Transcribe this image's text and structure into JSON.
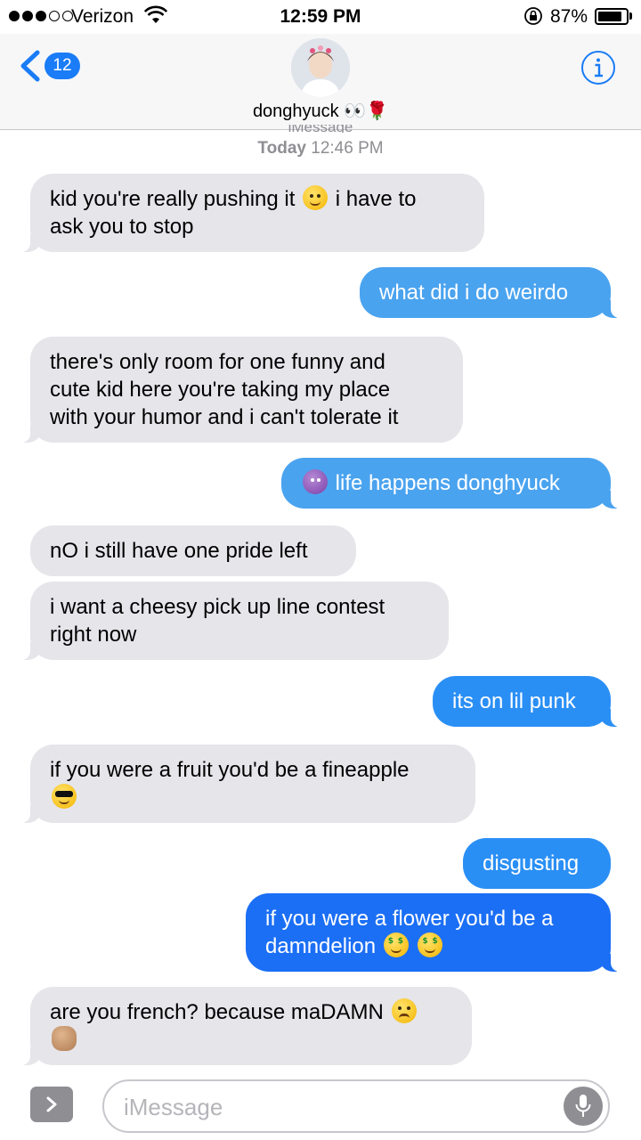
{
  "status_bar": {
    "carrier": "Verizon",
    "time": "12:59 PM",
    "battery_percent": "87%",
    "battery_level": 0.87,
    "signal_bars_filled": 3,
    "signal_bars_total": 5
  },
  "header": {
    "back_count": "12",
    "contact_name": "donghyuck 👀🌹",
    "info_icon": "info-icon"
  },
  "conversation": {
    "meta_label": "iMessage",
    "timestamp_day": "Today",
    "timestamp_time": "12:46 PM"
  },
  "messages": [
    {
      "from": "them",
      "lines": [
        "kid you're really pushing it",
        "ask you to stop"
      ],
      "line1_suffix": "i have to",
      "emoji": "steam-face"
    },
    {
      "from": "me",
      "lines": [
        "what did i do weirdo"
      ]
    },
    {
      "from": "them",
      "lines": [
        "there's only room for one funny and",
        "cute kid here you're taking my place",
        "with your humor and i can't tolerate it"
      ]
    },
    {
      "from": "me",
      "lines": [
        "life happens donghyuck"
      ],
      "emoji": "shrug-woman"
    },
    {
      "from": "them",
      "lines": [
        "nO i still have one pride left"
      ]
    },
    {
      "from": "them",
      "lines": [
        "i want a cheesy pick up line contest",
        "right now"
      ]
    },
    {
      "from": "me",
      "lines": [
        "its on lil punk"
      ]
    },
    {
      "from": "them",
      "lines": [
        "if you were a fruit you'd be a fineapple"
      ],
      "emoji": "sunglasses-face"
    },
    {
      "from": "me",
      "lines": [
        "disgusting"
      ]
    },
    {
      "from": "me",
      "lines": [
        "if you were a flower you'd be a",
        "damndelion"
      ],
      "emoji": "money-mouth-face"
    },
    {
      "from": "them",
      "lines": [
        "are you french? because maDAMN"
      ],
      "emoji": "tired-face, clapping-hands"
    }
  ],
  "input": {
    "placeholder": "iMessage"
  },
  "colors": {
    "incoming": "#e5e5ea",
    "outgoing": "#1a8cff",
    "accent": "#1a7cf6"
  }
}
